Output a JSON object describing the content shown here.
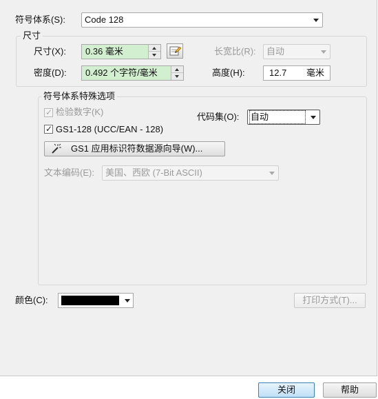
{
  "symbology": {
    "label": "符号体系(S):",
    "value": "Code 128"
  },
  "size_group": {
    "title": "尺寸",
    "size": {
      "label": "尺寸(X):",
      "value": "0.36 毫米"
    },
    "density": {
      "label": "密度(D):",
      "value": "0.492 个字符/毫米"
    },
    "aspect": {
      "label": "长宽比(R):",
      "value": "自动"
    },
    "height": {
      "label": "高度(H):",
      "value": "12.7",
      "unit": "毫米"
    }
  },
  "options_group": {
    "title": "符号体系特殊选项",
    "check_digit": {
      "label": "检验数字(K)",
      "checked": true,
      "enabled": false
    },
    "gs1": {
      "label": "GS1-128 (UCC/EAN - 128)",
      "checked": true
    },
    "code_set": {
      "label": "代码集(O):",
      "value": "自动"
    },
    "wizard_button": "GS1 应用标识符数据源向导(W)...",
    "encoding": {
      "label": "文本编码(E):",
      "value": "美国、西欧 (7-Bit ASCII)"
    }
  },
  "color": {
    "label": "颜色(C):",
    "value_hex": "#000000"
  },
  "print_button": "打印方式(T)...",
  "close_button": "关闭",
  "help_button": "帮助",
  "icons": {
    "edit": "pencil-edit-icon",
    "wand": "magic-wand-icon"
  }
}
